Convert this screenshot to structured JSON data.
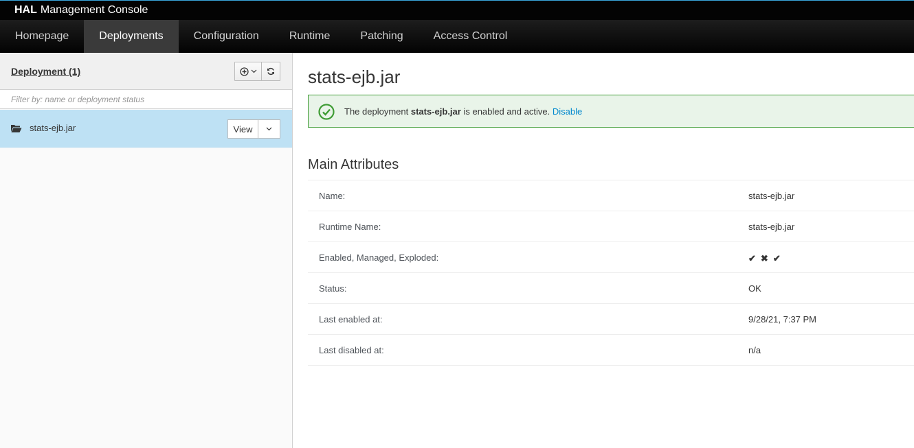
{
  "header": {
    "brand_strong": "HAL",
    "brand_rest": "Management Console"
  },
  "nav": {
    "items": [
      {
        "label": "Homepage",
        "active": false
      },
      {
        "label": "Deployments",
        "active": true
      },
      {
        "label": "Configuration",
        "active": false
      },
      {
        "label": "Runtime",
        "active": false
      },
      {
        "label": "Patching",
        "active": false
      },
      {
        "label": "Access Control",
        "active": false
      }
    ]
  },
  "left": {
    "title": "Deployment (1)",
    "filter_placeholder": "Filter by: name or deployment status",
    "items": [
      {
        "label": "stats-ejb.jar",
        "view_label": "View"
      }
    ]
  },
  "main": {
    "title": "stats-ejb.jar",
    "alert": {
      "prefix": "The deployment",
      "name": "stats-ejb.jar",
      "suffix": "is enabled and active.",
      "link": "Disable"
    },
    "section_title": "Main Attributes",
    "attributes": [
      {
        "label": "Name:",
        "value": "stats-ejb.jar"
      },
      {
        "label": "Runtime Name:",
        "value": "stats-ejb.jar"
      },
      {
        "label": "Enabled, Managed, Exploded:",
        "marks": [
          "✔",
          "✖",
          "✔"
        ]
      },
      {
        "label": "Status:",
        "value": "OK"
      },
      {
        "label": "Last enabled at:",
        "value": "9/28/21, 7:37 PM"
      },
      {
        "label": "Last disabled at:",
        "value": "n/a"
      }
    ]
  },
  "colors": {
    "accent": "#39a5dc",
    "success": "#3f9c35",
    "link": "#0088ce",
    "selected": "#bee1f4"
  },
  "icons": [
    "add-circle-icon",
    "chevron-down-icon",
    "refresh-icon",
    "folder-open-icon",
    "check-circle-icon"
  ]
}
